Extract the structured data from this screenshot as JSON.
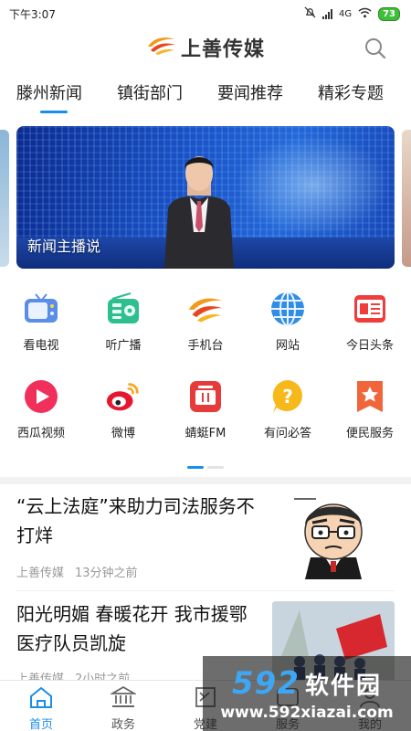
{
  "status_bar": {
    "time": "下午3:07",
    "signal": "4G",
    "battery": "73"
  },
  "header": {
    "brand": "上善传媒",
    "search_icon": "search-icon"
  },
  "tabs": [
    {
      "label": "滕州新闻",
      "active": true
    },
    {
      "label": "镇街部门",
      "active": false
    },
    {
      "label": "要闻推荐",
      "active": false
    },
    {
      "label": "精彩专题",
      "active": false
    }
  ],
  "banner": {
    "caption": "新闻主播说"
  },
  "shortcuts": [
    {
      "label": "看电视",
      "icon": "tv-icon"
    },
    {
      "label": "听广播",
      "icon": "radio-icon"
    },
    {
      "label": "手机台",
      "icon": "mobile-station-icon"
    },
    {
      "label": "网站",
      "icon": "globe-icon"
    },
    {
      "label": "今日头条",
      "icon": "toutiao-icon"
    },
    {
      "label": "西瓜视频",
      "icon": "xigua-video-icon"
    },
    {
      "label": "微博",
      "icon": "weibo-icon"
    },
    {
      "label": "蜻蜓FM",
      "icon": "qingting-fm-icon"
    },
    {
      "label": "有问必答",
      "icon": "question-icon"
    },
    {
      "label": "便民服务",
      "icon": "service-star-icon"
    }
  ],
  "news": [
    {
      "title": "“云上法庭”来助力司法服务不打烊",
      "source": "上善传媒",
      "time": "13分钟之前"
    },
    {
      "title": "阳光明媚 春暖花开 我市援鄂医疗队员凯旋",
      "source": "上善传媒",
      "time": "2小时之前"
    }
  ],
  "bottom_nav": [
    {
      "label": "首页",
      "icon": "home-icon",
      "active": true
    },
    {
      "label": "政务",
      "icon": "government-icon",
      "active": false
    },
    {
      "label": "党建",
      "icon": "party-icon",
      "active": false
    },
    {
      "label": "服务",
      "icon": "service-icon",
      "active": false
    },
    {
      "label": "我的",
      "icon": "user-icon",
      "active": false
    }
  ],
  "watermark": {
    "number": "592",
    "name": "软件园",
    "url": "www.592xiazai.com"
  },
  "colors": {
    "accent": "#1a8ee8",
    "banner": "#1b52c8"
  }
}
